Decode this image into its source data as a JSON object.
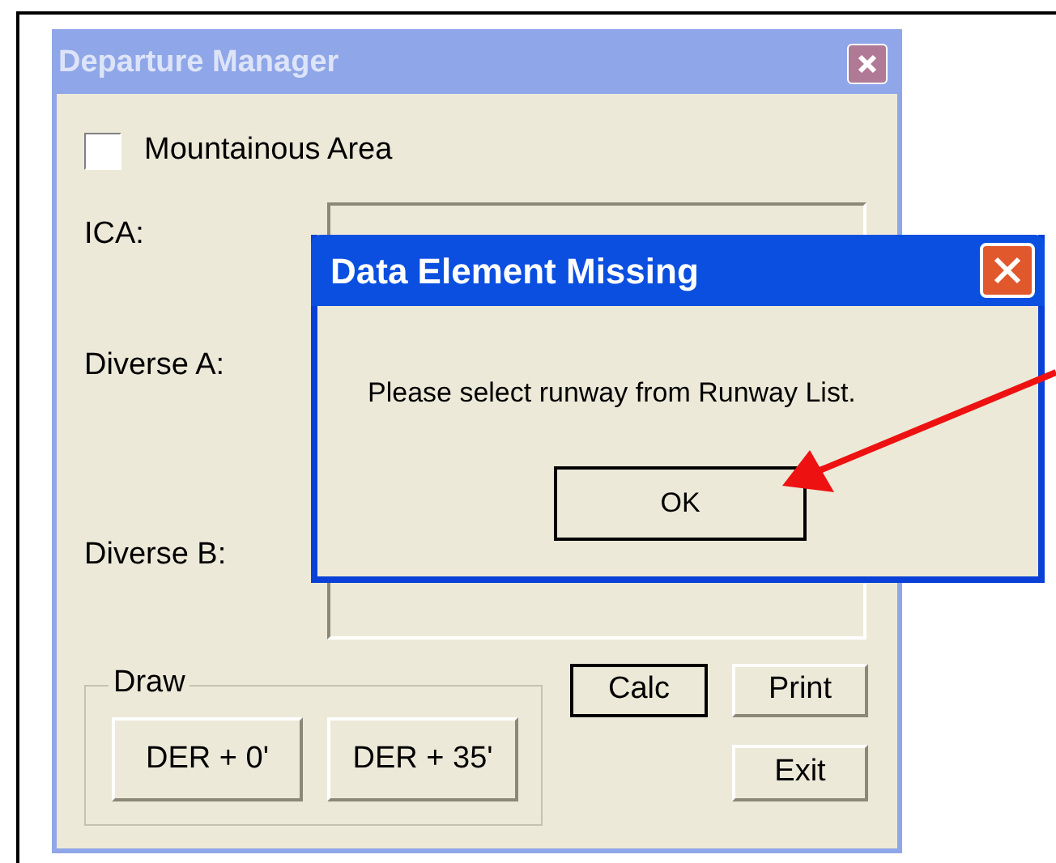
{
  "main_window": {
    "title": "Departure Manager",
    "active": false,
    "checkbox": {
      "label": "Mountainous Area",
      "checked": false
    },
    "fields": [
      {
        "label": "ICA:"
      },
      {
        "label": "Diverse A:"
      },
      {
        "label": "Diverse B:"
      }
    ],
    "draw_group": {
      "label": "Draw",
      "buttons": [
        "DER + 0'",
        "DER + 35'"
      ]
    },
    "buttons": [
      {
        "label": "Calc",
        "default": true
      },
      {
        "label": "Print",
        "default": false
      },
      {
        "label": "Exit",
        "default": false
      }
    ]
  },
  "dialog": {
    "title": "Data Element Missing",
    "active": true,
    "message": "Please select runway from Runway List.",
    "button": "OK"
  }
}
